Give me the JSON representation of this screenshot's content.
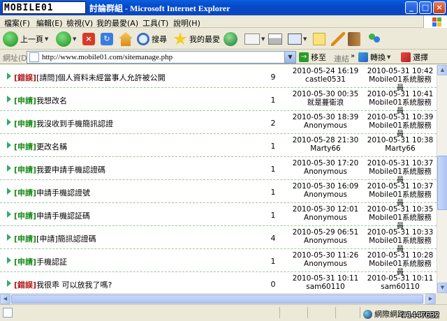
{
  "window": {
    "logo_text": "MOBILE01",
    "title": "討論群組 - Microsoft Internet Explorer"
  },
  "menu": [
    "檔案(F)",
    "編輯(E)",
    "檢視(V)",
    "我的最愛(A)",
    "工具(T)",
    "說明(H)"
  ],
  "toolbar": {
    "back": "上一頁",
    "search": "搜尋",
    "favorites": "我的最愛"
  },
  "address": {
    "label": "網址(D)",
    "url": "http://www.mobile01.com/sitemanage.php",
    "go": "移至",
    "links": "連結",
    "translate": "轉換",
    "select": "選擇"
  },
  "topics": [
    {
      "tag": "[錯誤]",
      "tag_color": "#b01818",
      "text": "[請問]個人資料未經當事人允許被公開",
      "count": "9",
      "created": "2010-05-24 16:19",
      "author": "castle0531",
      "updated": "2010-05-31 10:42",
      "updater": "Mobile01系統服務員"
    },
    {
      "tag": "[申請]",
      "tag_color": "#1a8a1a",
      "text": "我想改名",
      "count": "1",
      "created": "2010-05-30 00:35",
      "author": "就是蔓衛浪",
      "updated": "2010-05-31 10:41",
      "updater": "Mobile01系統服務員"
    },
    {
      "tag": "[申請]",
      "tag_color": "#1a8a1a",
      "text": "我沒收到手機簡訊認證",
      "count": "2",
      "created": "2010-05-30 18:39",
      "author": "Anonymous",
      "updated": "2010-05-31 10:39",
      "updater": "Mobile01系統服務員"
    },
    {
      "tag": "[申請]",
      "tag_color": "#1a8a1a",
      "text": "更改名稱",
      "count": "1",
      "created": "2010-05-28 21:30",
      "author": "Marty66",
      "updated": "2010-05-31 10:38",
      "updater": "Marty66"
    },
    {
      "tag": "[申請]",
      "tag_color": "#1a8a1a",
      "text": "我要申請手機認證碼",
      "count": "1",
      "created": "2010-05-30 17:20",
      "author": "Anonymous",
      "updated": "2010-05-31 10:37",
      "updater": "Mobile01系統服務員"
    },
    {
      "tag": "[申請]",
      "tag_color": "#1a8a1a",
      "text": "申請手機認證號",
      "count": "1",
      "created": "2010-05-30 16:09",
      "author": "Anonymous",
      "updated": "2010-05-31 10:37",
      "updater": "Mobile01系統服務員"
    },
    {
      "tag": "[申請]",
      "tag_color": "#1a8a1a",
      "text": "申請手機認証碼",
      "count": "1",
      "created": "2010-05-30 12:01",
      "author": "Anonymous",
      "updated": "2010-05-31 10:35",
      "updater": "Mobile01系統服務員"
    },
    {
      "tag": "[申請]",
      "tag_color": "#1a8a1a",
      "text": "[申請]簡訊認證碼",
      "count": "4",
      "created": "2010-05-29 06:51",
      "author": "Anonymous",
      "updated": "2010-05-31 10:33",
      "updater": "Mobile01系統服務員"
    },
    {
      "tag": "[申請]",
      "tag_color": "#1a8a1a",
      "text": "手機認証",
      "count": "1",
      "created": "2010-05-30 11:26",
      "author": "Anonymous",
      "updated": "2010-05-31 10:28",
      "updater": "Mobile01系統服務員"
    },
    {
      "tag": "[錯誤]",
      "tag_color": "#b01818",
      "text": "我很乖 可以放我了嗎?",
      "count": "0",
      "created": "2010-05-31 10:11",
      "author": "sam60110",
      "updated": "2010-05-31 10:11",
      "updater": "sam60110"
    }
  ],
  "status": {
    "zone": "網際網路",
    "watermark": "#1447632"
  },
  "colors": {
    "titlebar": "#0549c6",
    "row_border": "#9bc79b"
  }
}
